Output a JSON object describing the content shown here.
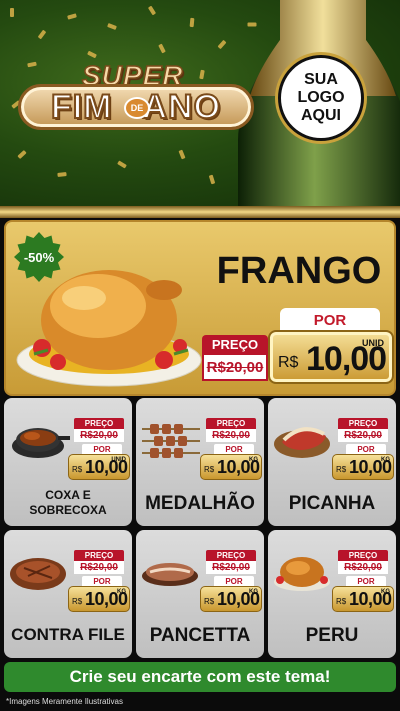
{
  "header": {
    "title_top": "SUPER",
    "title_main_left": "FIM",
    "title_de": "DE",
    "title_main_right": "ANO",
    "logo_lines": [
      "SUA",
      "LOGO",
      "AQUI"
    ]
  },
  "featured": {
    "badge": "-50%",
    "name": "FRANGO",
    "por_label": "POR",
    "preco_label": "PREÇO",
    "old_price": "R$20,00",
    "currency": "R$",
    "new_price": "10,00",
    "unit": "UNID"
  },
  "products": [
    {
      "name_lines": [
        "COXA E",
        "SOBRECOXA"
      ],
      "preco_label": "PREÇO",
      "old_price": "R$20,00",
      "por_label": "POR",
      "currency": "R$",
      "new_price": "10,00",
      "unit": "UNID",
      "icon": "chicken-thigh-icon"
    },
    {
      "name_lines": [
        "MEDALHÃO"
      ],
      "preco_label": "PREÇO",
      "old_price": "R$20,00",
      "por_label": "POR",
      "currency": "R$",
      "new_price": "10,00",
      "unit": "KG",
      "icon": "skewers-icon"
    },
    {
      "name_lines": [
        "PICANHA"
      ],
      "preco_label": "PREÇO",
      "old_price": "R$20,00",
      "por_label": "POR",
      "currency": "R$",
      "new_price": "10,00",
      "unit": "KG",
      "icon": "picanha-icon"
    },
    {
      "name_lines": [
        "CONTRA FILE"
      ],
      "preco_label": "PREÇO",
      "old_price": "R$20,00",
      "por_label": "POR",
      "currency": "R$",
      "new_price": "10,00",
      "unit": "KG",
      "icon": "steak-icon"
    },
    {
      "name_lines": [
        "PANCETTA"
      ],
      "preco_label": "PREÇO",
      "old_price": "R$20,00",
      "por_label": "POR",
      "currency": "R$",
      "new_price": "10,00",
      "unit": "KG",
      "icon": "pancetta-icon"
    },
    {
      "name_lines": [
        "PERU"
      ],
      "preco_label": "PREÇO",
      "old_price": "R$20,00",
      "por_label": "POR",
      "currency": "R$",
      "new_price": "10,00",
      "unit": "KG",
      "icon": "turkey-icon"
    }
  ],
  "footer": {
    "cta": "Crie seu encarte com este tema!",
    "disclaimer": "*Imagens Meramente Ilustrativas"
  },
  "colors": {
    "header_green": "#244a10",
    "gold": "#c89b36",
    "price_red": "#b8142a",
    "cta_green": "#2f8a2d",
    "card_grey": "#cfcfcf"
  }
}
